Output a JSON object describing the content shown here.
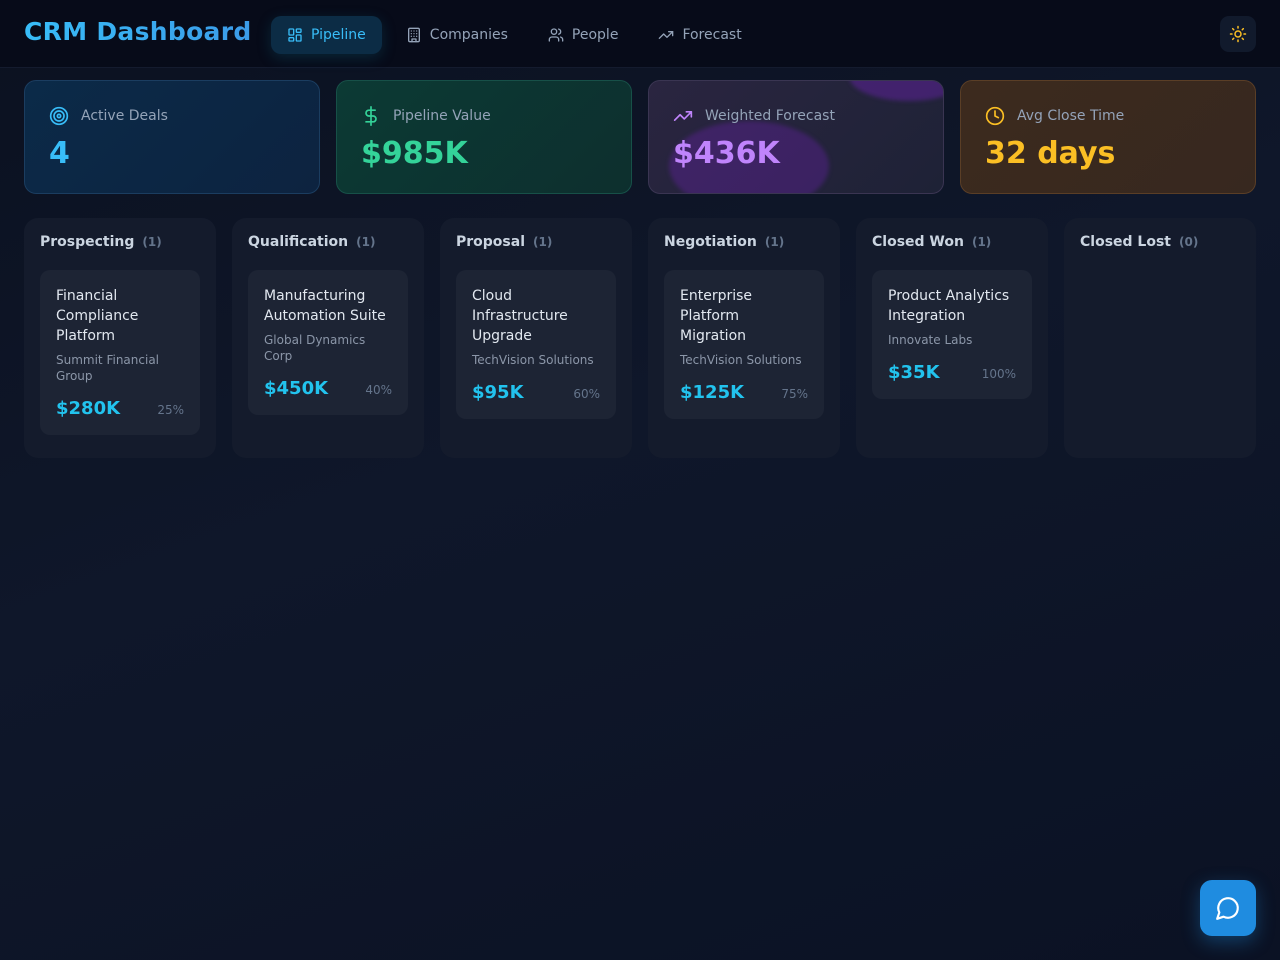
{
  "app": {
    "title": "CRM Dashboard"
  },
  "nav": {
    "items": [
      {
        "label": "Pipeline",
        "icon": "layout-grid-icon",
        "active": true
      },
      {
        "label": "Companies",
        "icon": "building-icon",
        "active": false
      },
      {
        "label": "People",
        "icon": "users-icon",
        "active": false
      },
      {
        "label": "Forecast",
        "icon": "trending-up-icon",
        "active": false
      }
    ]
  },
  "theme_toggle": {
    "icon": "sun-icon"
  },
  "stats": [
    {
      "label": "Active Deals",
      "value": "4",
      "icon": "target-icon",
      "color": "#38bdf8"
    },
    {
      "label": "Pipeline Value",
      "value": "$985K",
      "icon": "dollar-icon",
      "color": "#34d399"
    },
    {
      "label": "Weighted Forecast",
      "value": "$436K",
      "icon": "trending-up-icon",
      "color": "#c084fc"
    },
    {
      "label": "Avg Close Time",
      "value": "32 days",
      "icon": "clock-icon",
      "color": "#fbbf24"
    }
  ],
  "pipeline": {
    "columns": [
      {
        "title": "Prospecting",
        "count": "(1)",
        "deals": [
          {
            "title": "Financial Compliance Platform",
            "company": "Summit Financial Group",
            "value": "$280K",
            "probability": "25%"
          }
        ]
      },
      {
        "title": "Qualification",
        "count": "(1)",
        "deals": [
          {
            "title": "Manufacturing Automation Suite",
            "company": "Global Dynamics Corp",
            "value": "$450K",
            "probability": "40%"
          }
        ]
      },
      {
        "title": "Proposal",
        "count": "(1)",
        "deals": [
          {
            "title": "Cloud Infrastructure Upgrade",
            "company": "TechVision Solutions",
            "value": "$95K",
            "probability": "60%"
          }
        ]
      },
      {
        "title": "Negotiation",
        "count": "(1)",
        "deals": [
          {
            "title": "Enterprise Platform Migration",
            "company": "TechVision Solutions",
            "value": "$125K",
            "probability": "75%"
          }
        ]
      },
      {
        "title": "Closed Won",
        "count": "(1)",
        "deals": [
          {
            "title": "Product Analytics Integration",
            "company": "Innovate Labs",
            "value": "$35K",
            "probability": "100%"
          }
        ]
      },
      {
        "title": "Closed Lost",
        "count": "(0)",
        "deals": []
      }
    ]
  },
  "chat": {
    "icon": "message-circle-icon"
  }
}
